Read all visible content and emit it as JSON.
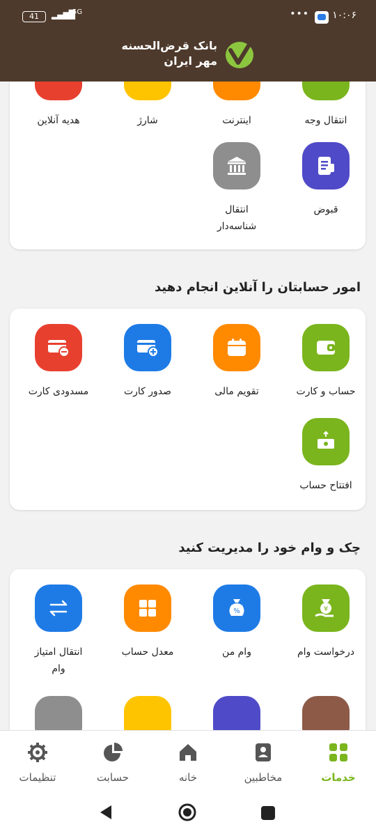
{
  "status": {
    "time": "۱۰:۰۶",
    "battery": "41",
    "network": "5G",
    "dots": "•••"
  },
  "brand": {
    "line1": "بانک قرض‌الحسنه",
    "line2": "مهر ایران"
  },
  "top_card": {
    "row1": [
      "انتقال وجه",
      "اینترنت",
      "شارژ",
      "هدیه آنلاین"
    ],
    "row2": [
      "قبوض",
      "انتقال شناسه‌دار"
    ]
  },
  "accounts_section": {
    "title": "امور حسابتان را آنلاین انجام دهید",
    "items": [
      "حساب و کارت",
      "تقویم مالی",
      "صدور کارت",
      "مسدودی کارت",
      "افتتاح حساب"
    ]
  },
  "loan_section": {
    "title": "چک و وام خود را مدیریت کنید",
    "items": [
      "درخواست وام",
      "وام من",
      "معدل حساب",
      "انتقال امتیاز وام"
    ]
  },
  "bottom_nav": {
    "items": [
      "خدمات",
      "مخاطبین",
      "خانه",
      "حسابت",
      "تنظیمات"
    ],
    "active": "خدمات"
  },
  "colors": {
    "header": "#4e3a2c",
    "green": "#7ab51d",
    "orange": "#ff8a00",
    "blue": "#1e7be6",
    "red": "#e8402f",
    "purple": "#4f4ac7",
    "gray": "#8e8e8e",
    "yellow": "#ffc400",
    "brown": "#8d5a47"
  }
}
